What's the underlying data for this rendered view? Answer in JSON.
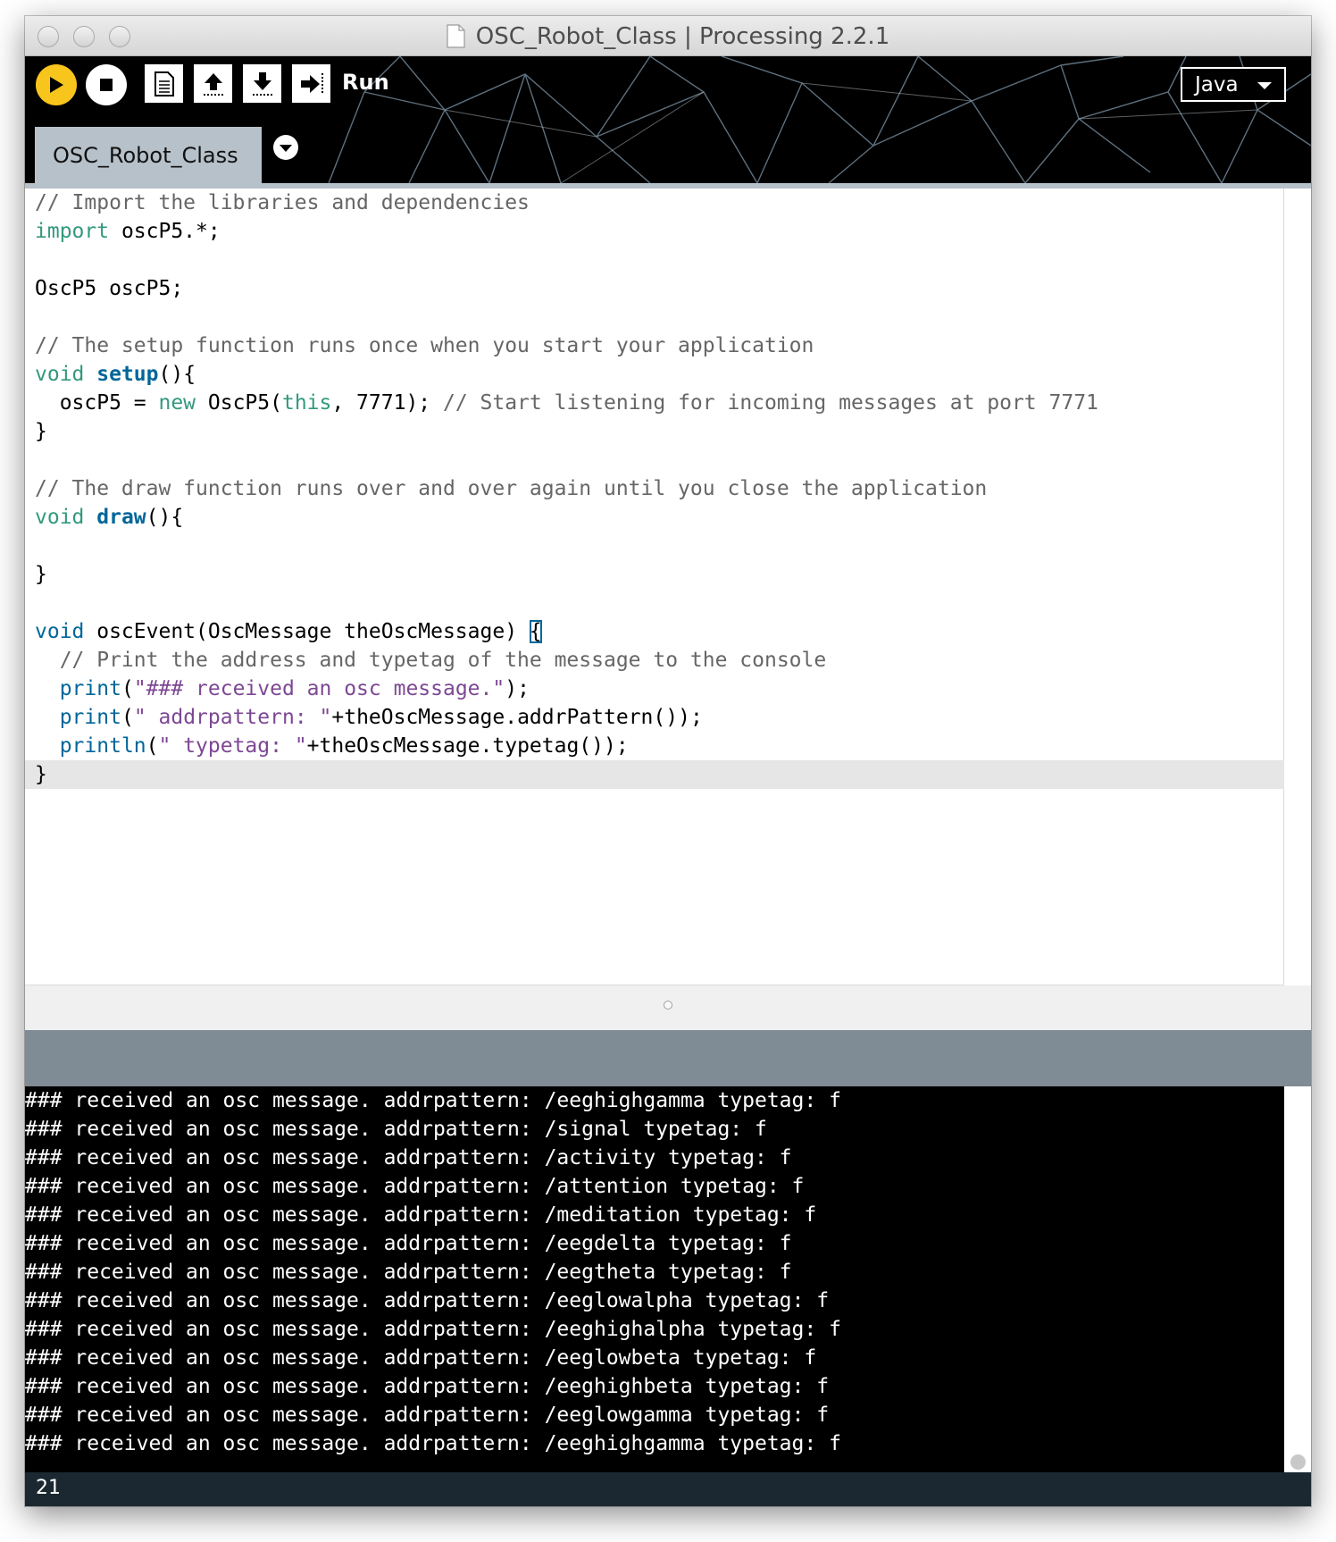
{
  "window": {
    "title": "OSC_Robot_Class | Processing 2.2.1"
  },
  "toolbar": {
    "run_label": "Run",
    "mode": "Java",
    "buttons": [
      "run",
      "stop",
      "new",
      "open",
      "save",
      "export"
    ]
  },
  "tabs": [
    {
      "label": "OSC_Robot_Class"
    }
  ],
  "colors": {
    "run_button": "#f8c51c",
    "tab": "#b7c1ca",
    "comment": "#666666",
    "keyword": "#33997e",
    "function": "#006699",
    "string": "#7d4793",
    "message_bar": "#7f8b95",
    "footer": "#1b2831"
  },
  "editor": {
    "current_line": 21,
    "lines": [
      [
        [
          "cm",
          "// Import the libraries and dependencies"
        ]
      ],
      [
        [
          "kw",
          "import"
        ],
        [
          "",
          " oscP5.*;"
        ]
      ],
      [],
      [
        [
          "",
          "OscP5 oscP5;"
        ]
      ],
      [],
      [
        [
          "cm",
          "// The setup function runs once when you start your application"
        ]
      ],
      [
        [
          "kw",
          "void"
        ],
        [
          "",
          " "
        ],
        [
          "fn",
          "setup"
        ],
        [
          "",
          "(){"
        ]
      ],
      [
        [
          "",
          "  oscP5 = "
        ],
        [
          "kw",
          "new"
        ],
        [
          "",
          " OscP5("
        ],
        [
          "kw",
          "this"
        ],
        [
          "",
          ", 7771); "
        ],
        [
          "cm",
          "// Start listening for incoming messages at port 7771"
        ]
      ],
      [
        [
          "",
          "}"
        ]
      ],
      [],
      [
        [
          "cm",
          "// The draw function runs over and over again until you close the application"
        ]
      ],
      [
        [
          "kw",
          "void"
        ],
        [
          "",
          " "
        ],
        [
          "fn",
          "draw"
        ],
        [
          "",
          "(){"
        ]
      ],
      [],
      [
        [
          "",
          "}"
        ]
      ],
      [],
      [
        [
          "kw2",
          "void"
        ],
        [
          "",
          " oscEvent(OscMessage theOscMessage) "
        ],
        [
          "bracket",
          "{"
        ]
      ],
      [
        [
          "cm",
          "  // Print the address and typetag of the message to the console"
        ]
      ],
      [
        [
          "",
          "  "
        ],
        [
          "kw2",
          "print"
        ],
        [
          "",
          "("
        ],
        [
          "st",
          "\"### received an osc message.\""
        ],
        [
          "",
          ");"
        ]
      ],
      [
        [
          "",
          "  "
        ],
        [
          "kw2",
          "print"
        ],
        [
          "",
          "("
        ],
        [
          "st",
          "\" addrpattern: \""
        ],
        [
          "",
          "+theOscMessage.addrPattern());"
        ]
      ],
      [
        [
          "",
          "  "
        ],
        [
          "kw2",
          "println"
        ],
        [
          "",
          "("
        ],
        [
          "st",
          "\" typetag: \""
        ],
        [
          "",
          "+theOscMessage.typetag());"
        ]
      ],
      [
        [
          "",
          "}"
        ]
      ]
    ]
  },
  "console": {
    "lines": [
      "### received an osc message. addrpattern: /eeghighgamma typetag: f",
      "### received an osc message. addrpattern: /signal typetag: f",
      "### received an osc message. addrpattern: /activity typetag: f",
      "### received an osc message. addrpattern: /attention typetag: f",
      "### received an osc message. addrpattern: /meditation typetag: f",
      "### received an osc message. addrpattern: /eegdelta typetag: f",
      "### received an osc message. addrpattern: /eegtheta typetag: f",
      "### received an osc message. addrpattern: /eeglowalpha typetag: f",
      "### received an osc message. addrpattern: /eeghighalpha typetag: f",
      "### received an osc message. addrpattern: /eeglowbeta typetag: f",
      "### received an osc message. addrpattern: /eeghighbeta typetag: f",
      "### received an osc message. addrpattern: /eeglowgamma typetag: f",
      "### received an osc message. addrpattern: /eeghighgamma typetag: f"
    ]
  },
  "status": {
    "line_number": "21"
  }
}
